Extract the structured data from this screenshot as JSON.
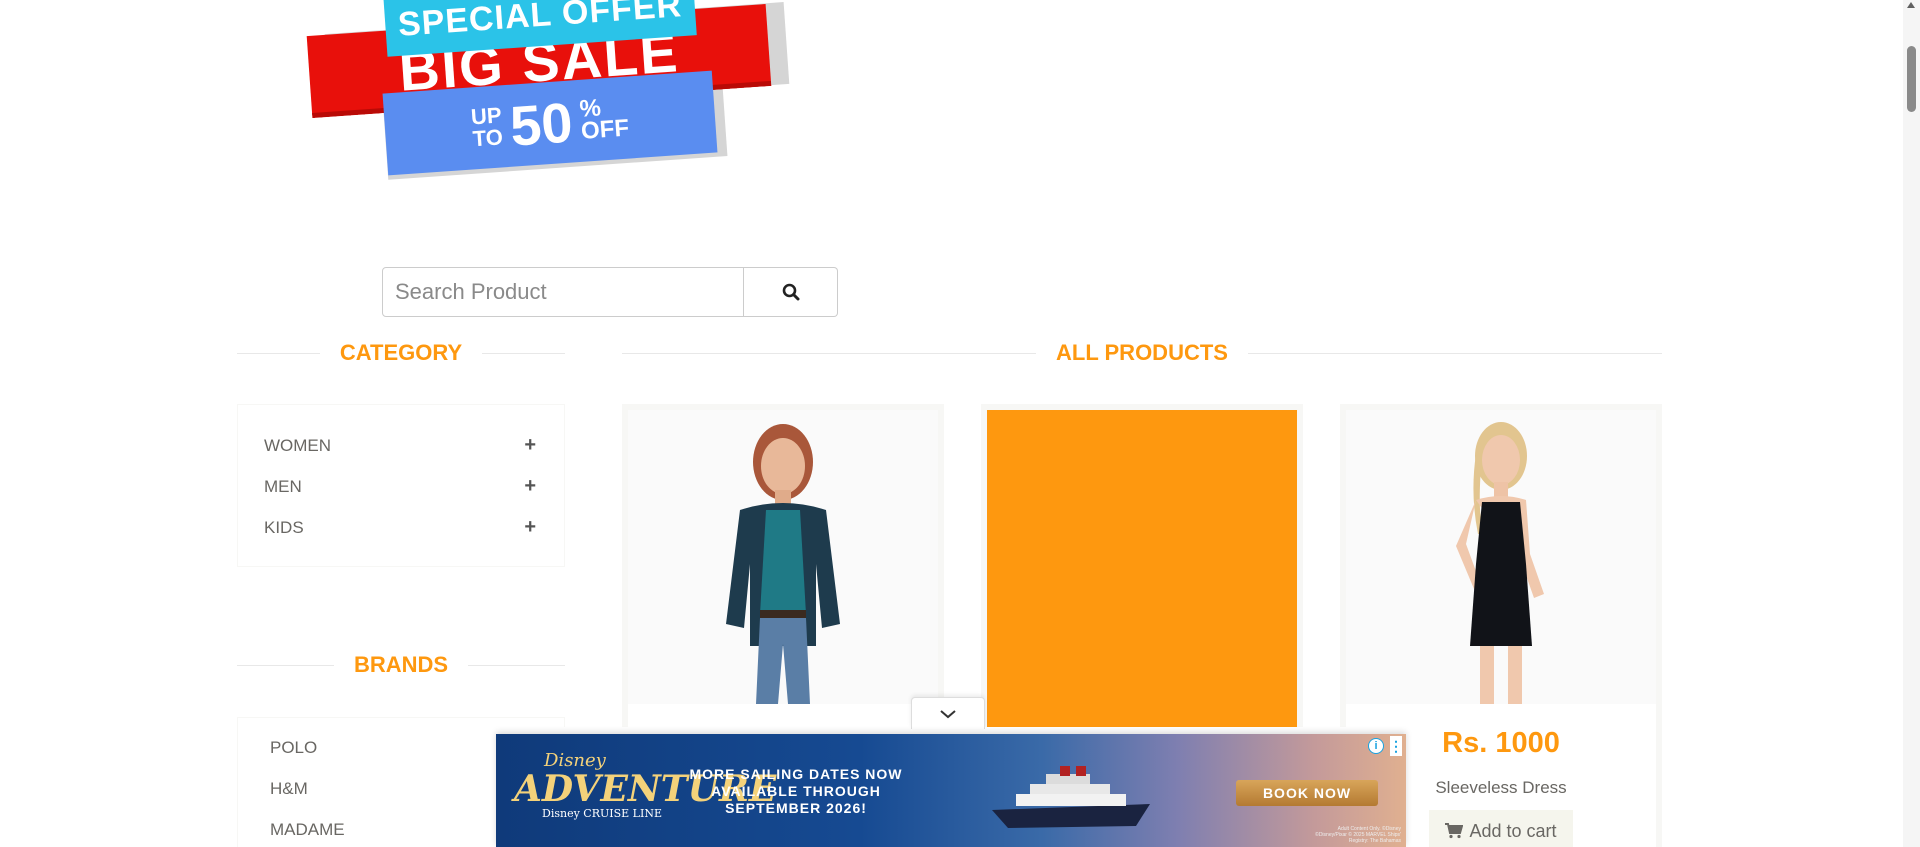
{
  "banner": {
    "special_offer": "SPECIAL OFFER",
    "big_sale": "BIG SALE",
    "up_to_line1": "UP",
    "up_to_line2": "TO",
    "percent_value": "50",
    "percent_suffix": "%",
    "off": "OFF"
  },
  "search": {
    "placeholder": "Search Product",
    "icon": "search-icon"
  },
  "category": {
    "title": "CATEGORY",
    "items": [
      {
        "label": "WOMEN",
        "icon": "plus-icon"
      },
      {
        "label": "MEN",
        "icon": "plus-icon"
      },
      {
        "label": "KIDS",
        "icon": "plus-icon"
      }
    ]
  },
  "brands": {
    "title": "BRANDS",
    "items": [
      {
        "label": "POLO"
      },
      {
        "label": "H&M"
      },
      {
        "label": "MADAME"
      }
    ]
  },
  "products": {
    "title": "ALL PRODUCTS",
    "items": [
      {
        "price": "",
        "name": "",
        "cart_label": ""
      },
      {
        "price": "",
        "name": "",
        "cart_label": ""
      },
      {
        "price": "Rs. 1000",
        "name": "Sleeveless Dress",
        "cart_label": "Add to cart"
      }
    ]
  },
  "ad": {
    "brand_top": "Disney",
    "brand_main": "ADVENTURE",
    "brand_bottom": "Disney CRUISE LINE",
    "message": "MORE SAILING DATES NOW AVAILABLE THROUGH SEPTEMBER 2026!",
    "cta": "BOOK NOW",
    "fine_print": "Adult Content Only. ©Disney ©Disney/Pixar © 2025 MARVEL Ships' Registry: The Bahamas",
    "info_icon": "info-icon",
    "menu_icon": "more-vertical-icon",
    "toggle_icon": "chevron-down-icon"
  },
  "colors": {
    "accent": "#fe980f",
    "text": "#696763",
    "sale_red": "#e8100b",
    "sale_cyan": "#2bc3e8",
    "sale_blue": "#5a8df0"
  }
}
